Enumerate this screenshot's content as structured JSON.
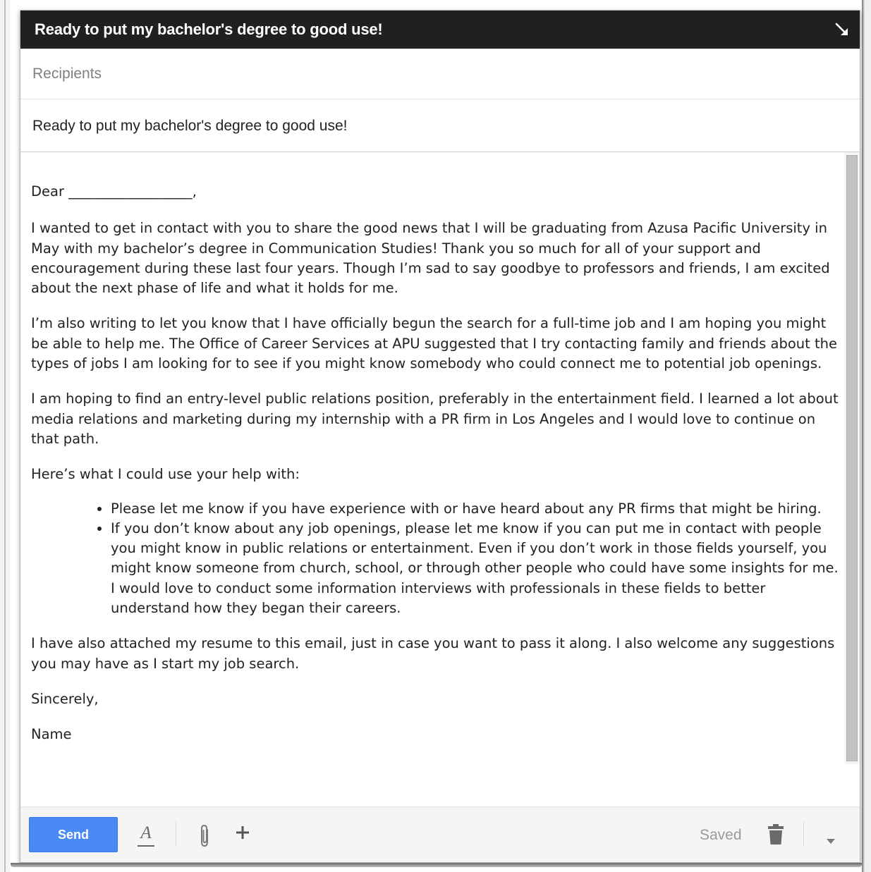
{
  "window": {
    "title": "Ready to put my bachelor's degree to good use!"
  },
  "recipients": {
    "placeholder": "Recipients"
  },
  "subject": {
    "value": "Ready to put my bachelor's degree to good use!"
  },
  "body": {
    "salutation": "Dear __________________,",
    "paragraphs": [
      "I wanted to get in contact with you to share the good news that I will be graduating from Azusa Pacific University in May with my bachelor’s degree in Communication Studies! Thank you so much for all of your support and encouragement during these last four years. Though I’m sad to say goodbye to professors and friends, I am excited about the next phase of life and what it holds for me.",
      "I’m also writing to let you know that I have officially begun the search for a full-time job and I am hoping you might be able to help me. The Office of Career Services at APU suggested that I try contacting family and friends about the types of jobs I am looking for to see if you might know somebody who could connect me to potential job openings.",
      "I am hoping to find an entry-level public relations position, preferably in the entertainment field. I learned a lot about media relations and marketing during my internship with a PR firm in Los Angeles and I would love to continue on that path.",
      "Here’s what I could use your help with:"
    ],
    "bullets": [
      "Please let me know if you have experience with or have heard about any PR firms that might be hiring.",
      "If you don’t know about any job openings, please let me know if you can put me in contact with people you might know in public relations or entertainment. Even if you don’t work in those fields yourself, you might know someone from church, school, or through other people who could have some insights for me. I would love to conduct some information interviews with professionals in these fields to better understand how they began their careers."
    ],
    "closing_paragraph": "I have also attached my resume to this email, just in case you want to pass it along. I also welcome any suggestions you may have as I start my job search.",
    "signoff": "Sincerely,",
    "signature": "Name"
  },
  "footer": {
    "send_label": "Send",
    "format_icon": "A",
    "status": "Saved"
  },
  "icons": {
    "expand": "arrow-down-right-icon",
    "format": "text-format-icon",
    "attach": "paperclip-icon",
    "insert": "plus-icon",
    "discard": "trash-icon",
    "more": "chevron-down-icon"
  },
  "colors": {
    "titlebar": "#202020",
    "send_button": "#4a8af4",
    "status_text": "#9a9a9a"
  }
}
